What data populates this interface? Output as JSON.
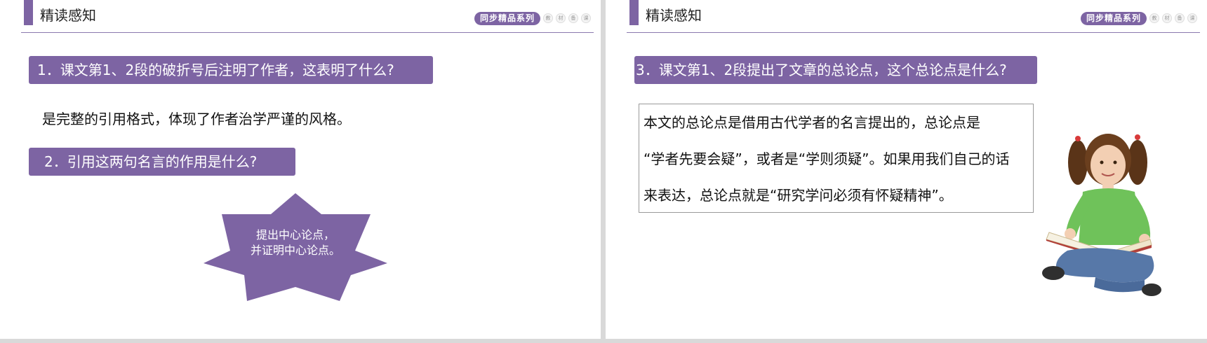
{
  "left_slide": {
    "header_title": "精读感知",
    "series_label": "同步精品系列",
    "series_dots": [
      "教",
      "材",
      "备",
      "课"
    ],
    "question1": "1．课文第1、2段的破折号后注明了作者，这表明了什么?",
    "answer1": "是完整的引用格式，体现了作者治学严谨的风格。",
    "question2": "2．引用这两句名言的作用是什么?",
    "star_line1": "提出中心论点，",
    "star_line2": "并证明中心论点。"
  },
  "right_slide": {
    "header_title": "精读感知",
    "series_label": "同步精品系列",
    "series_dots": [
      "教",
      "材",
      "备",
      "课"
    ],
    "question3": "3．课文第1、2段提出了文章的总论点，这个总论点是什么?",
    "answer_line1": " 本文的总论点是借用古代学者的名言提出的，总论点是",
    "answer_line2": "“学者先要会疑”，或者是“学则须疑”。如果用我们自己的话",
    "answer_line3": "来表达，总论点就是“研究学问必须有怀疑精神”。"
  },
  "colors": {
    "accent": "#7d64a3",
    "header_line": "#8a79ae"
  }
}
